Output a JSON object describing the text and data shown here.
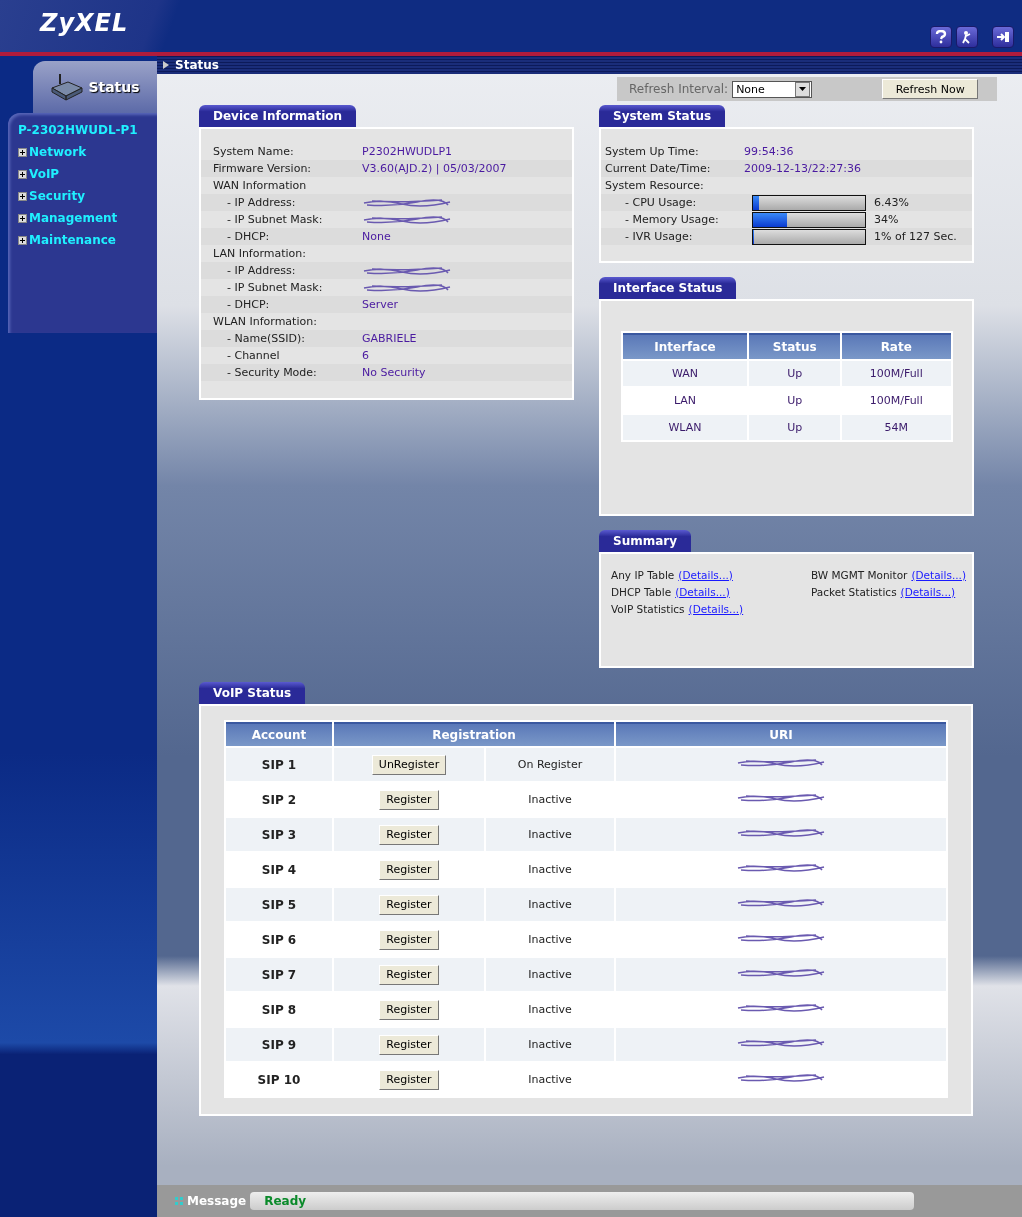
{
  "header": {
    "logo": "ZyXEL"
  },
  "breadcrumb": "Status",
  "sidebar": {
    "tab": "Status",
    "device": "P-2302HWUDL-P1",
    "items": [
      {
        "label": "Network",
        "expanded": false
      },
      {
        "label": "VoIP",
        "expanded": false
      },
      {
        "label": "Security",
        "expanded": false
      },
      {
        "label": "Management",
        "expanded": false
      },
      {
        "label": "Maintenance",
        "expanded": false
      }
    ]
  },
  "refresh": {
    "label": "Refresh Interval:",
    "value": "None",
    "button": "Refresh Now"
  },
  "device_information": {
    "title": "Device Information",
    "rows": [
      {
        "label": "System Name:",
        "value": "P2302HWUDLP1"
      },
      {
        "label": "Firmware Version:",
        "value": "V3.60(AJD.2) | 05/03/2007"
      },
      {
        "label": "WAN Information",
        "children": [
          {
            "label": "- IP Address:",
            "redacted": true
          },
          {
            "label": "- IP Subnet Mask:",
            "redacted": true
          },
          {
            "label": "- DHCP:",
            "value": "None"
          }
        ]
      },
      {
        "label": "LAN Information:",
        "children": [
          {
            "label": "- IP Address:",
            "redacted": true
          },
          {
            "label": "- IP Subnet Mask:",
            "redacted": true
          },
          {
            "label": "- DHCP:",
            "value": "Server"
          }
        ]
      },
      {
        "label": "WLAN Information:",
        "children": [
          {
            "label": "- Name(SSID):",
            "value": "GABRIELE"
          },
          {
            "label": "- Channel",
            "value": "6"
          },
          {
            "label": "- Security Mode:",
            "value": "No Security"
          }
        ]
      }
    ]
  },
  "system_status": {
    "title": "System Status",
    "rows": [
      {
        "kind": "text",
        "label": "System Up Time:",
        "value": "99:54:36"
      },
      {
        "kind": "text",
        "label": "Current Date/Time:",
        "value": "2009-12-13/22:27:36"
      },
      {
        "kind": "heading",
        "label": "System Resource:"
      },
      {
        "kind": "meter",
        "label": "- CPU Usage:",
        "level": 0.05,
        "reading": "6.43%"
      },
      {
        "kind": "meter",
        "label": "- Memory Usage:",
        "level": 0.3,
        "reading": "34%"
      },
      {
        "kind": "meter",
        "label": "- IVR Usage:",
        "level": 0.01,
        "reading": "1% of 127 Sec."
      }
    ]
  },
  "interface_status": {
    "title": "Interface Status",
    "columns": [
      "Interface",
      "Status",
      "Rate"
    ],
    "rows": [
      [
        "WAN",
        "Up",
        "100M/Full"
      ],
      [
        "LAN",
        "Up",
        "100M/Full"
      ],
      [
        "WLAN",
        "Up",
        "54M"
      ]
    ]
  },
  "summary": {
    "title": "Summary",
    "items": [
      {
        "label": "Any IP Table",
        "link": "(Details...)"
      },
      {
        "label": "BW MGMT Monitor",
        "link": "(Details...)"
      },
      {
        "label": "DHCP Table",
        "link": "(Details...)"
      },
      {
        "label": "Packet Statistics",
        "link": "(Details...)"
      },
      {
        "label": "VoIP Statistics",
        "link": "(Details...)"
      }
    ]
  },
  "voip_status": {
    "title": "VoIP Status",
    "columns": [
      "Account",
      "Registration",
      "URI"
    ],
    "rows": [
      {
        "account": "SIP 1",
        "button": "UnRegister",
        "state": "On Register"
      },
      {
        "account": "SIP 2",
        "button": "Register",
        "state": "Inactive"
      },
      {
        "account": "SIP 3",
        "button": "Register",
        "state": "Inactive"
      },
      {
        "account": "SIP 4",
        "button": "Register",
        "state": "Inactive"
      },
      {
        "account": "SIP 5",
        "button": "Register",
        "state": "Inactive"
      },
      {
        "account": "SIP 6",
        "button": "Register",
        "state": "Inactive"
      },
      {
        "account": "SIP 7",
        "button": "Register",
        "state": "Inactive"
      },
      {
        "account": "SIP 8",
        "button": "Register",
        "state": "Inactive"
      },
      {
        "account": "SIP 9",
        "button": "Register",
        "state": "Inactive"
      },
      {
        "account": "SIP 10",
        "button": "Register",
        "state": "Inactive"
      }
    ]
  },
  "message": {
    "label": "Message",
    "value": "Ready"
  }
}
